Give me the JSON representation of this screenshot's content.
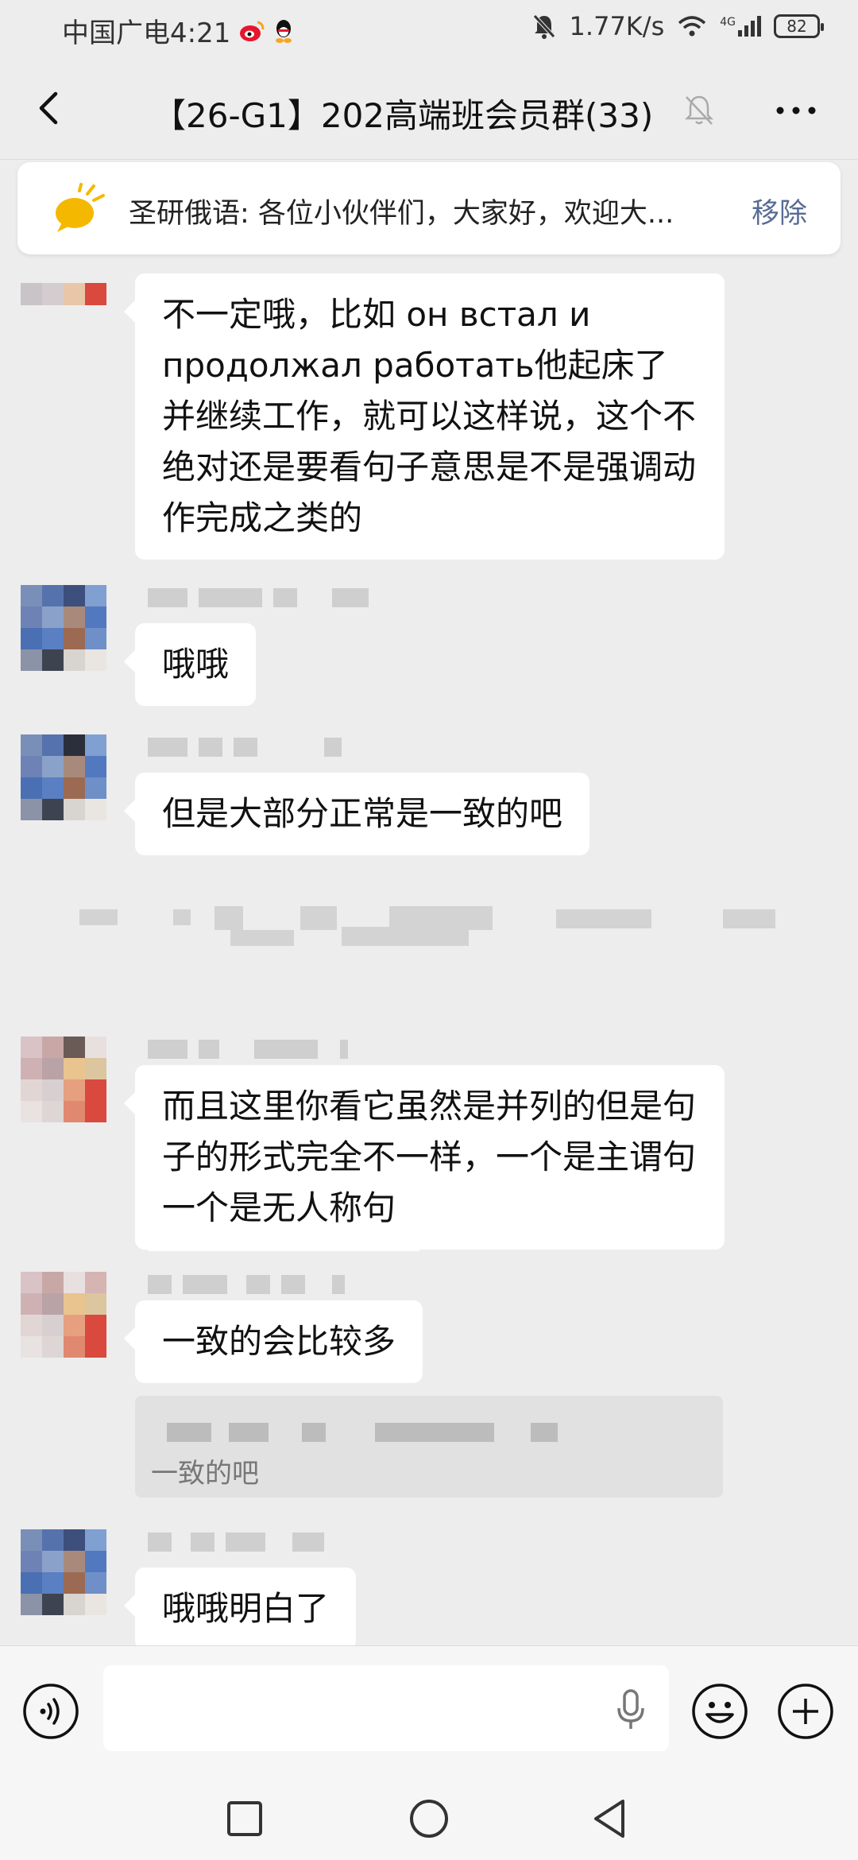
{
  "status_bar": {
    "carrier_time": "中国广电4:21",
    "net_speed": "1.77K/s",
    "network": "4G",
    "battery": "82"
  },
  "header": {
    "title": "【26-G1】202高端班会员群(33)"
  },
  "announcement": {
    "text": "圣研俄语: 各位小伙伴们，大家好，欢迎大...",
    "remove_label": "移除"
  },
  "messages": [
    {
      "text": "不一定哦，比如 он встал и продолжал работать他起床了并继续工作，就可以这样说，这个不绝对还是要看句子意思是不是强调动作完成之类的"
    },
    {
      "text": "哦哦"
    },
    {
      "text": "但是大部分正常是一致的吧"
    },
    {
      "text": "而且这里你看它虽然是并列的但是句子的形式完全不一样，一个是主谓句一个是无人称句"
    },
    {
      "text": "一致的会比较多"
    },
    {
      "text": "哦哦明白了"
    }
  ],
  "quote": {
    "text": "一致的吧"
  },
  "input": {
    "placeholder": ""
  },
  "icons": {
    "back": "chevron-left-icon",
    "mute": "bell-off-icon",
    "more": "more-dots-icon",
    "announce": "speech-bubble-icon",
    "voice": "voice-icon",
    "mic": "mic-icon",
    "emoji": "emoji-icon",
    "plus": "plus-icon"
  },
  "colors": {
    "background": "#ededed",
    "link": "#576b95",
    "announce_icon": "#f5b800"
  }
}
